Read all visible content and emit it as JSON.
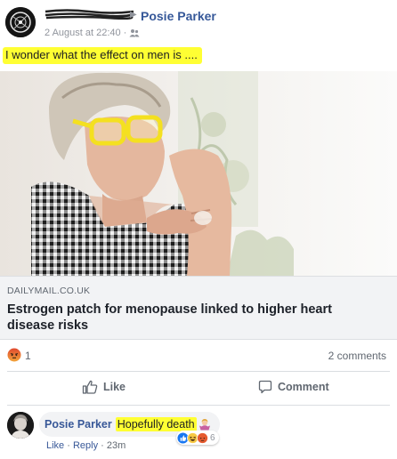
{
  "post": {
    "author": "Posie Parker",
    "arrow": "▶",
    "timestamp": "2 August at 22:40",
    "separator": "·",
    "text": "I wonder what the effect on men is ....",
    "friends_icon": "friends-icon"
  },
  "link": {
    "domain": "DAILYMAIL.CO.UK",
    "title": "Estrogen patch for menopause linked to higher heart disease risks"
  },
  "reactions": {
    "icon": "angry-reaction-icon",
    "count": "1",
    "comments": "2 comments"
  },
  "actions": {
    "like": "Like",
    "comment": "Comment"
  },
  "comment": {
    "author": "Posie Parker",
    "text": "Hopefully death",
    "emoji": "woman-shrugging-emoji",
    "reaction_count": "6",
    "like": "Like",
    "dot": "·",
    "reply": "Reply",
    "age": "23m"
  },
  "colors": {
    "highlight": "#ffff33",
    "link_blue": "#365899",
    "muted": "#606770",
    "caption_bg": "#f2f3f5",
    "glasses_yellow": "#f4e020"
  }
}
